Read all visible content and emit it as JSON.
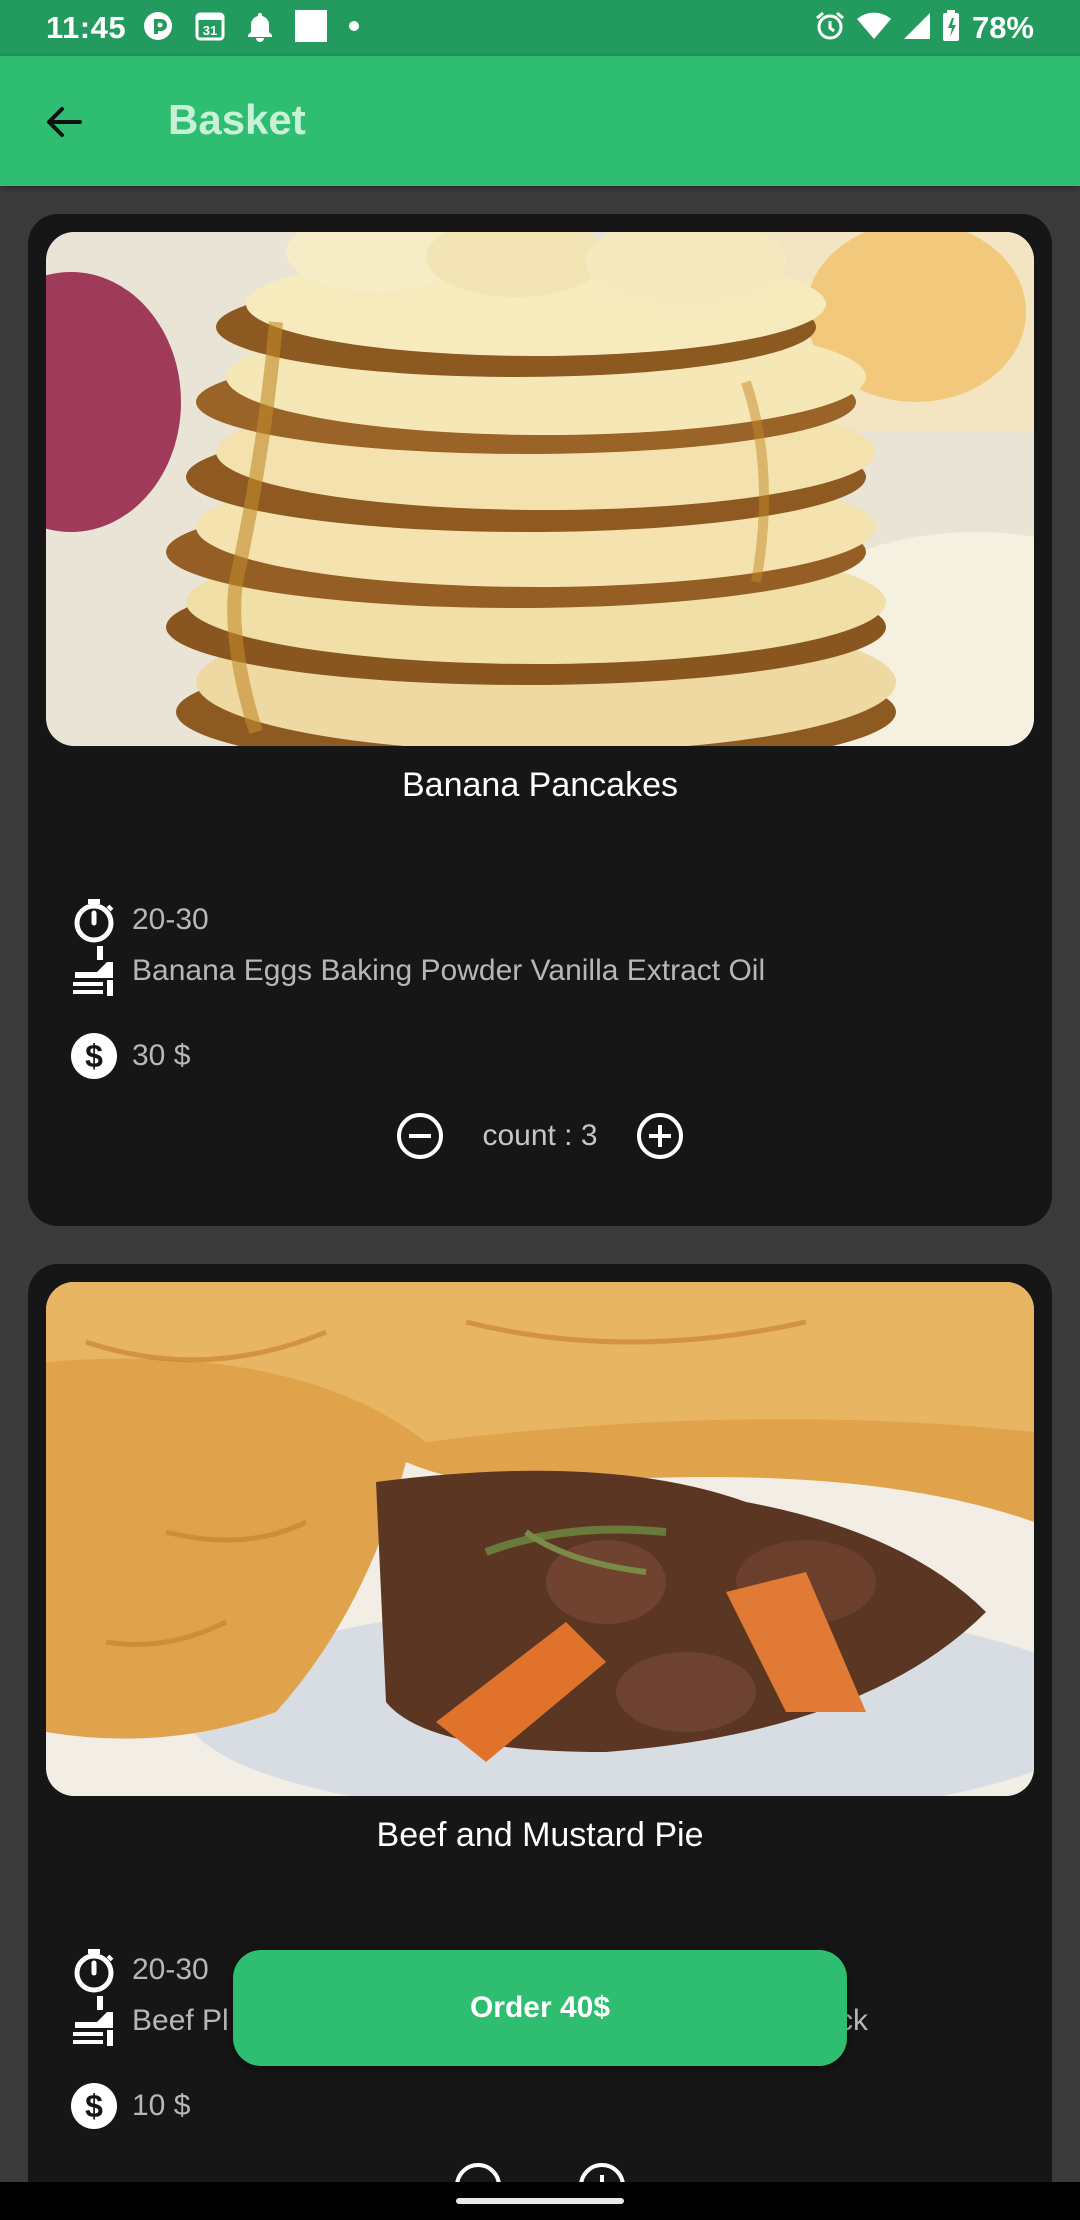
{
  "status_bar": {
    "time": "11:45",
    "battery": "78%",
    "left_icons": [
      "pocket-casts-icon",
      "calendar-icon",
      "notification-bell-icon",
      "square-notification-icon",
      "dot-icon"
    ],
    "right_icons": [
      "alarm-icon",
      "wifi-icon",
      "signal-icon",
      "battery-icon"
    ]
  },
  "app_bar": {
    "title": "Basket",
    "back_icon": "arrow-back-icon"
  },
  "items": [
    {
      "name": "Banana Pancakes",
      "time": "20-30",
      "ingredients": "Banana Eggs Baking Powder Vanilla Extract Oil",
      "price": "30 $",
      "count": "count : 3"
    },
    {
      "name": "Beef and Mustard Pie",
      "time": "20-30",
      "ingredients_visible_start": "Beef Pl",
      "ingredients_visible_end": "ck",
      "price": "10 $"
    }
  ],
  "order_button": {
    "label": "Order 40$"
  },
  "colors": {
    "status_bar": "#239b5e",
    "app_bar": "#2ebd71",
    "title_text": "#c9f1d8",
    "card": "#161616",
    "background": "#3b3b3b"
  }
}
